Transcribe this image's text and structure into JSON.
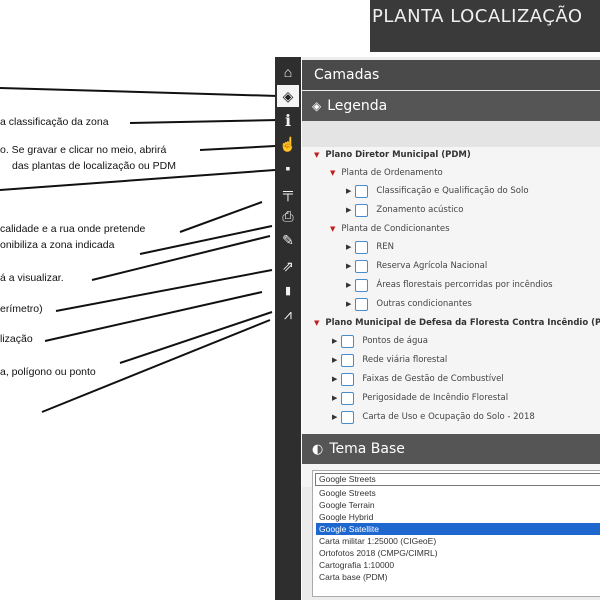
{
  "banner": {
    "title": "PLANTA LOCALIZAÇÃO"
  },
  "annotations": [
    "a classificação da zona",
    "o. Se gravar e clicar no meio, abrirá",
    "das plantas de localização ou PDM",
    "calidade e a rua onde pretende",
    "onibiliza a zona indicada",
    "á a visualizar.",
    "erímetro)",
    "lização",
    "a, polígono ou ponto"
  ],
  "toolbar": {
    "buttons": [
      {
        "name": "home-icon",
        "glyph": "⌂"
      },
      {
        "name": "layers-icon",
        "glyph": "◈"
      },
      {
        "name": "info-icon",
        "glyph": "i"
      },
      {
        "name": "pointer-icon",
        "glyph": "☝"
      },
      {
        "name": "comment-icon",
        "glyph": "▪"
      },
      {
        "name": "measure-icon",
        "glyph": "╤"
      },
      {
        "name": "print-icon",
        "glyph": "⎙"
      },
      {
        "name": "draw-icon",
        "glyph": "✎"
      },
      {
        "name": "share-icon",
        "glyph": "⇗"
      },
      {
        "name": "file-icon",
        "glyph": "▮"
      },
      {
        "name": "road-icon",
        "glyph": "⩘"
      }
    ]
  },
  "panel": {
    "camadas": "Camadas",
    "legenda": "Legenda",
    "tema_base": "Tema Base"
  },
  "tree": {
    "pdm": "Plano Diretor Municipal (PDM)",
    "ordenamento": "Planta de Ordenamento",
    "ord_items": [
      "Classificação e Qualificação do Solo",
      "Zonamento acústico"
    ],
    "condicionantes": "Planta de Condicionantes",
    "cond_items": [
      "REN",
      "Reserva Agrícola Nacional",
      "Áreas florestais percorridas por incêndios",
      "Outras condicionantes"
    ],
    "pmdfci": "Plano Municipal de Defesa da Floresta Contra Incêndio (P",
    "pmdfci_items": [
      "Pontos de água",
      "Rede viária florestal",
      "Faixas de Gestão de Combustível",
      "Perigosidade de Incêndio Florestal",
      "Carta de Uso e Ocupação do Solo - 2018"
    ]
  },
  "base_select": {
    "selected": "Google Streets",
    "options": [
      "Google Streets",
      "Google Terrain",
      "Google Hybrid",
      "Google Satellite",
      "Carta militar 1:25000 (CIGeoE)",
      "Ortofotos 2018 (CMPG/CIMRL)",
      "Cartografia 1:10000",
      "Carta base (PDM)"
    ],
    "highlighted": "Google Satellite"
  }
}
